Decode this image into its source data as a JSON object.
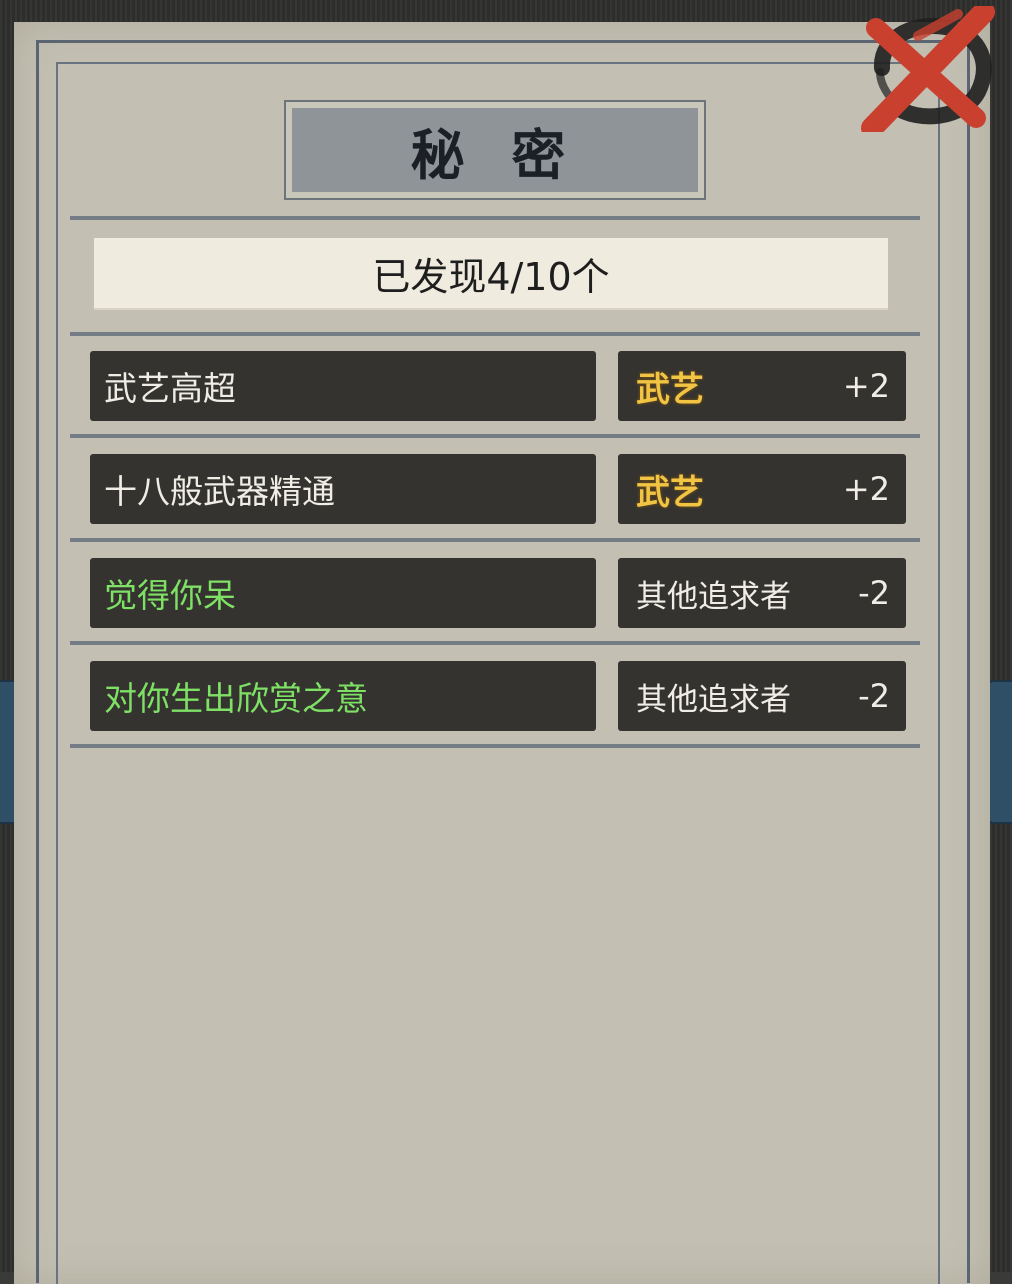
{
  "panel": {
    "title": "秘 密",
    "discovered": "已发现4/10个"
  },
  "secrets": [
    {
      "name": "武艺高超",
      "name_color": "white",
      "effect": "武艺",
      "effect_style": "gold",
      "value": "+2"
    },
    {
      "name": "十八般武器精通",
      "name_color": "white",
      "effect": "武艺",
      "effect_style": "gold",
      "value": "+2"
    },
    {
      "name": "觉得你呆",
      "name_color": "green",
      "effect": "其他追求者",
      "effect_style": "plain",
      "value": "-2"
    },
    {
      "name": "对你生出欣赏之意",
      "name_color": "green",
      "effect": "其他追求者",
      "effect_style": "plain",
      "value": "-2"
    }
  ],
  "colors": {
    "paper": "#c3c0b3",
    "row_bg": "#34332f",
    "green_text": "#7fe066",
    "gold_text": "#f1c443",
    "close_red": "#c9402f"
  },
  "icons": {
    "close": "close-x-icon"
  }
}
